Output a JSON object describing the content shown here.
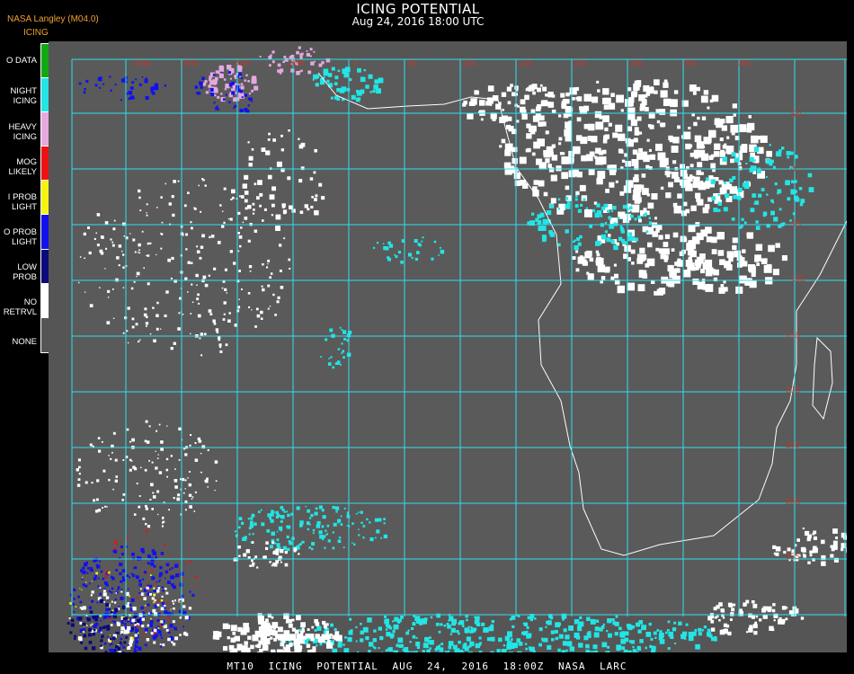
{
  "header": {
    "provider": "NASA Langley (M04.0)",
    "title": "ICING POTENTIAL",
    "datetime": "Aug 24, 2016 18:00 UTC"
  },
  "legend": {
    "title": "ICING",
    "items": [
      {
        "label": "O DATA",
        "color": "#11a811"
      },
      {
        "label": "NIGHT\nICING",
        "color": "#22e5e5"
      },
      {
        "label": "HEAVY\nICING",
        "color": "#e6a8de"
      },
      {
        "label": "MOG\nLIKELY",
        "color": "#ee1111"
      },
      {
        "label": "I PROB\nLIGHT",
        "color": "#f5f511"
      },
      {
        "label": "O PROB\nLIGHT",
        "color": "#1111ee"
      },
      {
        "label": "LOW\nPROB",
        "color": "#0a0a7a"
      },
      {
        "label": "NO\nRETRVL",
        "color": "#ffffff"
      },
      {
        "label": "NONE",
        "color": "#555555"
      }
    ]
  },
  "map": {
    "background_color": "#555555",
    "grid_color": "#2ee0ee",
    "coast_color": "#ffffff",
    "lon_labels": [
      "40W",
      "30W",
      "20W",
      "10W",
      "0",
      "5E",
      "10E",
      "15E",
      "20E",
      "25E",
      "30E",
      "35E"
    ],
    "lat_labels": [
      "5N",
      "0",
      "5S",
      "10S",
      "15S",
      "20S",
      "25S",
      "30S",
      "35S"
    ]
  },
  "footer": {
    "text": "MT10  ICING POTENTIAL   AUG 24, 2016 18:00Z   NASA LARC"
  }
}
